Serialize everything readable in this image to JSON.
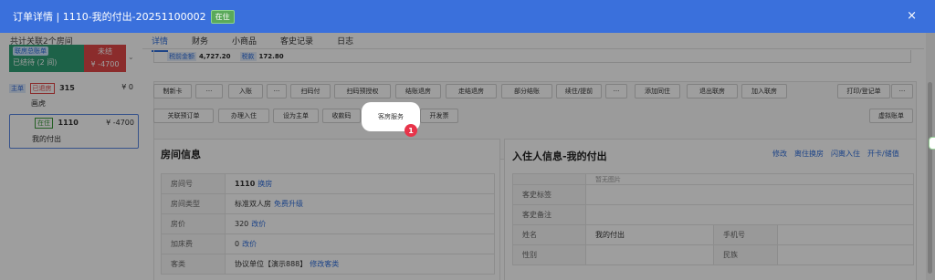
{
  "header": {
    "title": "订单详情 | 1110-我的付出-20251100002",
    "status_badge": "在住",
    "close": "×"
  },
  "left": {
    "title": "共计关联2个房间",
    "summary": {
      "tag": "联房总账单",
      "status": "已结待 (2 间)",
      "red_label": "未结",
      "red_amount": "¥ -4700"
    },
    "rooms": [
      {
        "tag": "主单",
        "status_tag": "已退房",
        "number": "315",
        "amount": "¥ 0",
        "name": "画虎"
      },
      {
        "status_tag": "在住",
        "number": "1110",
        "amount": "¥ -4700",
        "name": "我的付出"
      }
    ]
  },
  "tabs": [
    "详情",
    "财务",
    "小商品",
    "客史记录",
    "日志"
  ],
  "feebar": {
    "tag1": "税前金额",
    "val1": "4,727.20",
    "tag2": "税款",
    "val2": "172.80"
  },
  "actions": {
    "row1": [
      "制新卡",
      "···",
      "入账",
      "···",
      "扫码付",
      "扫码预授权",
      "结账退房",
      "走结退房",
      "部分结账",
      "续住/提前",
      "···",
      "添加同住",
      "退出联房",
      "加入联房",
      "打印/登记单",
      "···"
    ],
    "row2": [
      "关联预订单",
      "办理入住",
      "设为主单",
      "收款码",
      "客房服务",
      "开发票",
      "虚拟账单"
    ]
  },
  "marker": "1",
  "room_info": {
    "title": "房间信息",
    "rows": [
      {
        "k": "房间号",
        "v": "1110",
        "link": "换房"
      },
      {
        "k": "房间类型",
        "v": "标准双人房",
        "link": "免费升级"
      },
      {
        "k": "房价",
        "v": "320",
        "link": "改价"
      },
      {
        "k": "加床费",
        "v": "0",
        "link": "改价"
      },
      {
        "k": "客类",
        "v": "协议单位【演示888】",
        "link": "修改客类"
      }
    ]
  },
  "guest_info": {
    "title": "入住人信息-我的付出",
    "links": [
      "修改",
      "离住换房",
      "闪离入住",
      "开卡/储值"
    ],
    "photo": "暂无图片",
    "rows": [
      {
        "k": "客史标签"
      },
      {
        "k": "客史备注"
      },
      {
        "k": "姓名",
        "v": "我的付出",
        "k2": "手机号"
      },
      {
        "k": "性别",
        "k2": "民族"
      }
    ]
  }
}
